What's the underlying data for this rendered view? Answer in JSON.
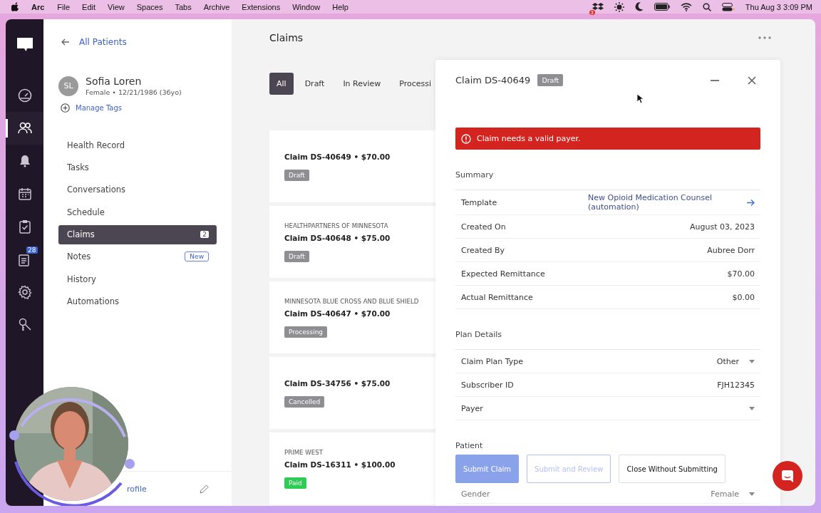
{
  "menubar": {
    "app": "Arc",
    "menus": [
      "File",
      "Edit",
      "View",
      "Spaces",
      "Tabs",
      "Archive",
      "Extensions",
      "Window",
      "Help"
    ],
    "status_badge": "3",
    "clock": "Thu Aug 3  3:09 PM"
  },
  "rail": [
    {
      "kind": "chat",
      "selected": false
    },
    {
      "kind": "dashboard",
      "selected": false
    },
    {
      "kind": "people",
      "selected": true
    },
    {
      "kind": "bell",
      "selected": false
    },
    {
      "kind": "calendar",
      "selected": false
    },
    {
      "kind": "clipboard",
      "selected": false
    },
    {
      "kind": "notes",
      "selected": false,
      "badge": "28"
    },
    {
      "kind": "gear",
      "selected": false
    },
    {
      "kind": "keys",
      "selected": false
    }
  ],
  "patient": {
    "back_link": "All Patients",
    "initials": "SL",
    "name": "Sofia Loren",
    "details": "Female • 12/21/1986 (36yo)",
    "tags_link": "Manage Tags"
  },
  "nav": [
    {
      "label": "Health Record",
      "selected": false
    },
    {
      "label": "Tasks",
      "selected": false
    },
    {
      "label": "Conversations",
      "selected": false
    },
    {
      "label": "Schedule",
      "selected": false
    },
    {
      "label": "Claims",
      "selected": true,
      "count": "2"
    },
    {
      "label": "Notes",
      "selected": false,
      "badge": "New"
    },
    {
      "label": "History",
      "selected": false
    },
    {
      "label": "Automations",
      "selected": false
    }
  ],
  "footer_link": "rofile",
  "claims": {
    "title": "Claims",
    "tabs": [
      {
        "label": "All",
        "selected": true
      },
      {
        "label": "Draft",
        "selected": false
      },
      {
        "label": "In Review",
        "selected": false
      },
      {
        "label": "Processi",
        "selected": false
      }
    ],
    "cards": [
      {
        "title": "Claim DS-40649 • $70.00",
        "status": "Draft",
        "color": "#8e8e93"
      },
      {
        "payer": "HEALTHPARTNERS OF MINNESOTA",
        "title": "Claim DS-40648 • $75.00",
        "status": "Draft",
        "color": "#8e8e93"
      },
      {
        "payer": "MINNESOTA BLUE CROSS AND BLUE SHIELD",
        "title": "Claim DS-40647 • $70.00",
        "status": "Processing",
        "color": "#8e8e93"
      },
      {
        "title": "Claim DS-34756 • $75.00",
        "status": "Cancelled",
        "color": "#8e8e93"
      },
      {
        "payer": "PRIME WEST",
        "title": "Claim DS-16311 • $100.00",
        "status": "Paid",
        "color": "#2ecc55"
      }
    ]
  },
  "drawer": {
    "title": "Claim DS-40649",
    "status": "Draft",
    "alert": "Claim needs a valid payer.",
    "sections": [
      {
        "heading": "Summary",
        "rows": [
          {
            "label": "Template",
            "value": "New Opioid Medication Counsel (automation)",
            "kind": "link"
          },
          {
            "label": "Created On",
            "value": "August 03, 2023",
            "kind": "text"
          },
          {
            "label": "Created By",
            "value": "Aubree Dorr",
            "kind": "text"
          },
          {
            "label": "Expected Remittance",
            "value": "$70.00",
            "kind": "text"
          },
          {
            "label": "Actual Remittance",
            "value": "$0.00",
            "kind": "text"
          }
        ]
      },
      {
        "heading": "Plan Details",
        "rows": [
          {
            "label": "Claim Plan Type",
            "value": "Other",
            "kind": "select"
          },
          {
            "label": "Subscriber ID",
            "value": "FJH12345",
            "kind": "text"
          },
          {
            "label": "Payer",
            "kind": "select"
          }
        ]
      },
      {
        "heading": "Patient",
        "rows": [
          {
            "label": "Gender",
            "value": "Female",
            "kind": "select"
          }
        ]
      }
    ],
    "buttons": [
      {
        "label": "Submit Claim",
        "kind": "primary",
        "disabled": true
      },
      {
        "label": "Submit and Review",
        "kind": "outline",
        "disabled": true
      },
      {
        "label": "Close Without Submitting",
        "kind": "plain",
        "disabled": false
      }
    ]
  }
}
